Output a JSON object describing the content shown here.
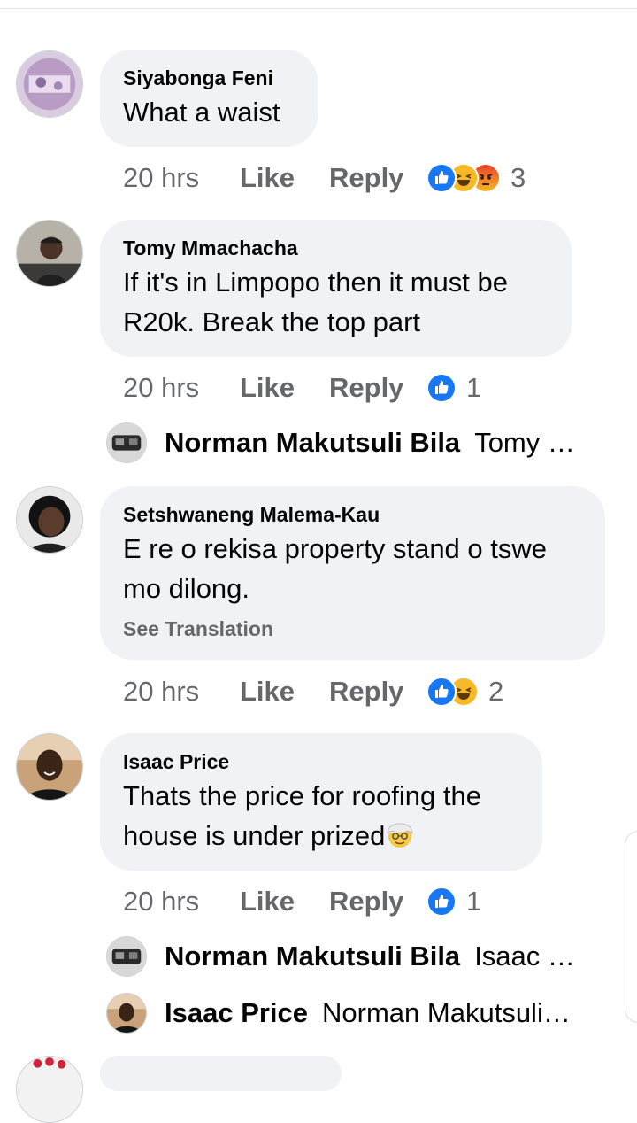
{
  "comments": [
    {
      "author": "Siyabonga Feni",
      "text": "What a waist",
      "time": "20 hrs",
      "like_label": "Like",
      "reply_label": "Reply",
      "reactions": [
        "like",
        "haha",
        "angry"
      ],
      "reaction_count": "3"
    },
    {
      "author": "Tomy Mmachacha",
      "text": "If it's in Limpopo then it must be R20k. Break the top part",
      "time": "20 hrs",
      "like_label": "Like",
      "reply_label": "Reply",
      "reactions": [
        "like"
      ],
      "reaction_count": "1",
      "replies": [
        {
          "author": "Norman Makutsuli Bila",
          "text": "Tomy …"
        }
      ]
    },
    {
      "author": "Setshwaneng Malema-Kau",
      "text": "E re o rekisa property stand o tswe mo dilong.",
      "see_translation": "See Translation",
      "time": "20 hrs",
      "like_label": "Like",
      "reply_label": "Reply",
      "reactions": [
        "like",
        "haha"
      ],
      "reaction_count": "2"
    },
    {
      "author": "Isaac Price",
      "text": "Thats the price for roofing the house is under prized",
      "trailing_emoji": "older-man-emoji",
      "time": "20 hrs",
      "like_label": "Like",
      "reply_label": "Reply",
      "reactions": [
        "like"
      ],
      "reaction_count": "1",
      "replies": [
        {
          "author": "Norman Makutsuli Bila",
          "text": "Isaac …"
        },
        {
          "author": "Isaac Price",
          "text": "Norman Makutsuli…"
        }
      ]
    }
  ],
  "colors": {
    "bubble": "#f0f2f5",
    "meta_text": "#65676b",
    "like_blue": "#1877f2",
    "haha_yellow": "#f7b928",
    "angry_orange": "#e9710f"
  }
}
